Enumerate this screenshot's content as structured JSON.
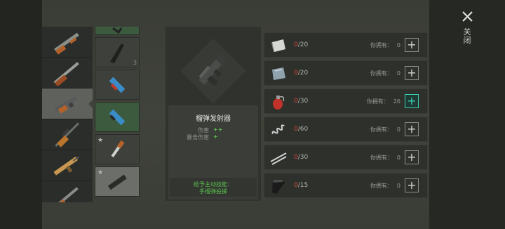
{
  "close": {
    "label": "关闭",
    "icon": "close-icon"
  },
  "weapon_list": [
    {
      "name": "shotgun-pump",
      "selected": false
    },
    {
      "name": "shotgun-double",
      "selected": false
    },
    {
      "name": "grenade-launcher",
      "selected": true
    },
    {
      "name": "sniper-rifle",
      "selected": false
    },
    {
      "name": "assault-rifle",
      "selected": false
    },
    {
      "name": "rifle",
      "selected": false
    }
  ],
  "mod_list": [
    {
      "name": "mod-top",
      "style": "green",
      "starred": false,
      "num": ""
    },
    {
      "name": "mod-stock",
      "style": "dark",
      "starred": false,
      "num": "3"
    },
    {
      "name": "mod-scope-blue",
      "style": "dark",
      "starred": false,
      "num": ""
    },
    {
      "name": "mod-scope-blue-2",
      "style": "green",
      "starred": false,
      "num": ""
    },
    {
      "name": "mod-knife",
      "style": "dark",
      "starred": true,
      "num": ""
    },
    {
      "name": "mod-barrel",
      "style": "light",
      "starred": true,
      "num": ""
    }
  ],
  "detail": {
    "weapon_name": "榴弹发射器",
    "stats": [
      {
        "label": "伤害",
        "value": "++"
      },
      {
        "label": "暴击伤害",
        "value": "+"
      }
    ],
    "skill_title": "给予主动技能：",
    "skill_name": "手榴弹投掷"
  },
  "materials": [
    {
      "icon": "metal-plate-icon",
      "current": "0",
      "required": "/20",
      "owned_label": "你拥有：",
      "owned": "0",
      "active": false
    },
    {
      "icon": "glass-plate-icon",
      "current": "0",
      "required": "/20",
      "owned_label": "你拥有：",
      "owned": "0",
      "active": false
    },
    {
      "icon": "grenade-icon",
      "current": "0",
      "required": "/30",
      "owned_label": "你拥有：",
      "owned": "26",
      "active": true
    },
    {
      "icon": "spring-icon",
      "current": "0",
      "required": "/60",
      "owned_label": "你拥有：",
      "owned": "0",
      "active": false
    },
    {
      "icon": "rods-icon",
      "current": "0",
      "required": "/30",
      "owned_label": "你拥有：",
      "owned": "0",
      "active": false
    },
    {
      "icon": "rubber-roll-icon",
      "current": "0",
      "required": "/15",
      "owned_label": "你拥有：",
      "owned": "0",
      "active": false
    }
  ],
  "colors": {
    "accent": "#3ad0b0",
    "deficit": "#d84a3e",
    "positive": "#5bbf4e"
  }
}
